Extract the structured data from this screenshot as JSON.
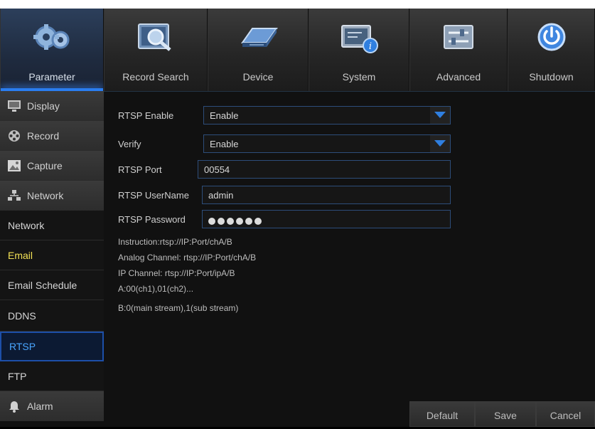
{
  "tabs": [
    {
      "label": "Parameter",
      "icon": "gears-icon"
    },
    {
      "label": "Record Search",
      "icon": "search-film-icon"
    },
    {
      "label": "Device",
      "icon": "hard-drive-icon"
    },
    {
      "label": "System",
      "icon": "info-monitor-icon"
    },
    {
      "label": "Advanced",
      "icon": "sliders-icon"
    },
    {
      "label": "Shutdown",
      "icon": "power-icon"
    }
  ],
  "sidebar": {
    "items": [
      {
        "label": "Display",
        "icon": "monitor-icon"
      },
      {
        "label": "Record",
        "icon": "film-reel-icon"
      },
      {
        "label": "Capture",
        "icon": "image-icon"
      },
      {
        "label": "Network",
        "icon": "network-icon"
      },
      {
        "label": "Network"
      },
      {
        "label": "Email"
      },
      {
        "label": "Email Schedule"
      },
      {
        "label": "DDNS"
      },
      {
        "label": "RTSP"
      },
      {
        "label": "FTP"
      },
      {
        "label": "Alarm",
        "icon": "bell-icon"
      }
    ]
  },
  "form": {
    "rtsp_enable": {
      "label": "RTSP Enable",
      "value": "Enable"
    },
    "verify": {
      "label": "Verify",
      "value": "Enable"
    },
    "rtsp_port": {
      "label": "RTSP Port",
      "value": "00554"
    },
    "rtsp_username": {
      "label": "RTSP UserName",
      "value": "admin"
    },
    "rtsp_password": {
      "label": "RTSP Password",
      "dots": 6
    }
  },
  "instructions": [
    "Instruction:rtsp://IP:Port/chA/B",
    "Analog Channel:  rtsp://IP:Port/chA/B",
    "IP Channel:  rtsp://IP:Port/ipA/B",
    "A:00(ch1),01(ch2)...",
    "B:0(main stream),1(sub stream)"
  ],
  "buttons": {
    "default": "Default",
    "save": "Save",
    "cancel": "Cancel"
  },
  "colors": {
    "accent": "#2a7df0",
    "selected_text": "#4aa6ff",
    "email_text": "#f3e255"
  }
}
